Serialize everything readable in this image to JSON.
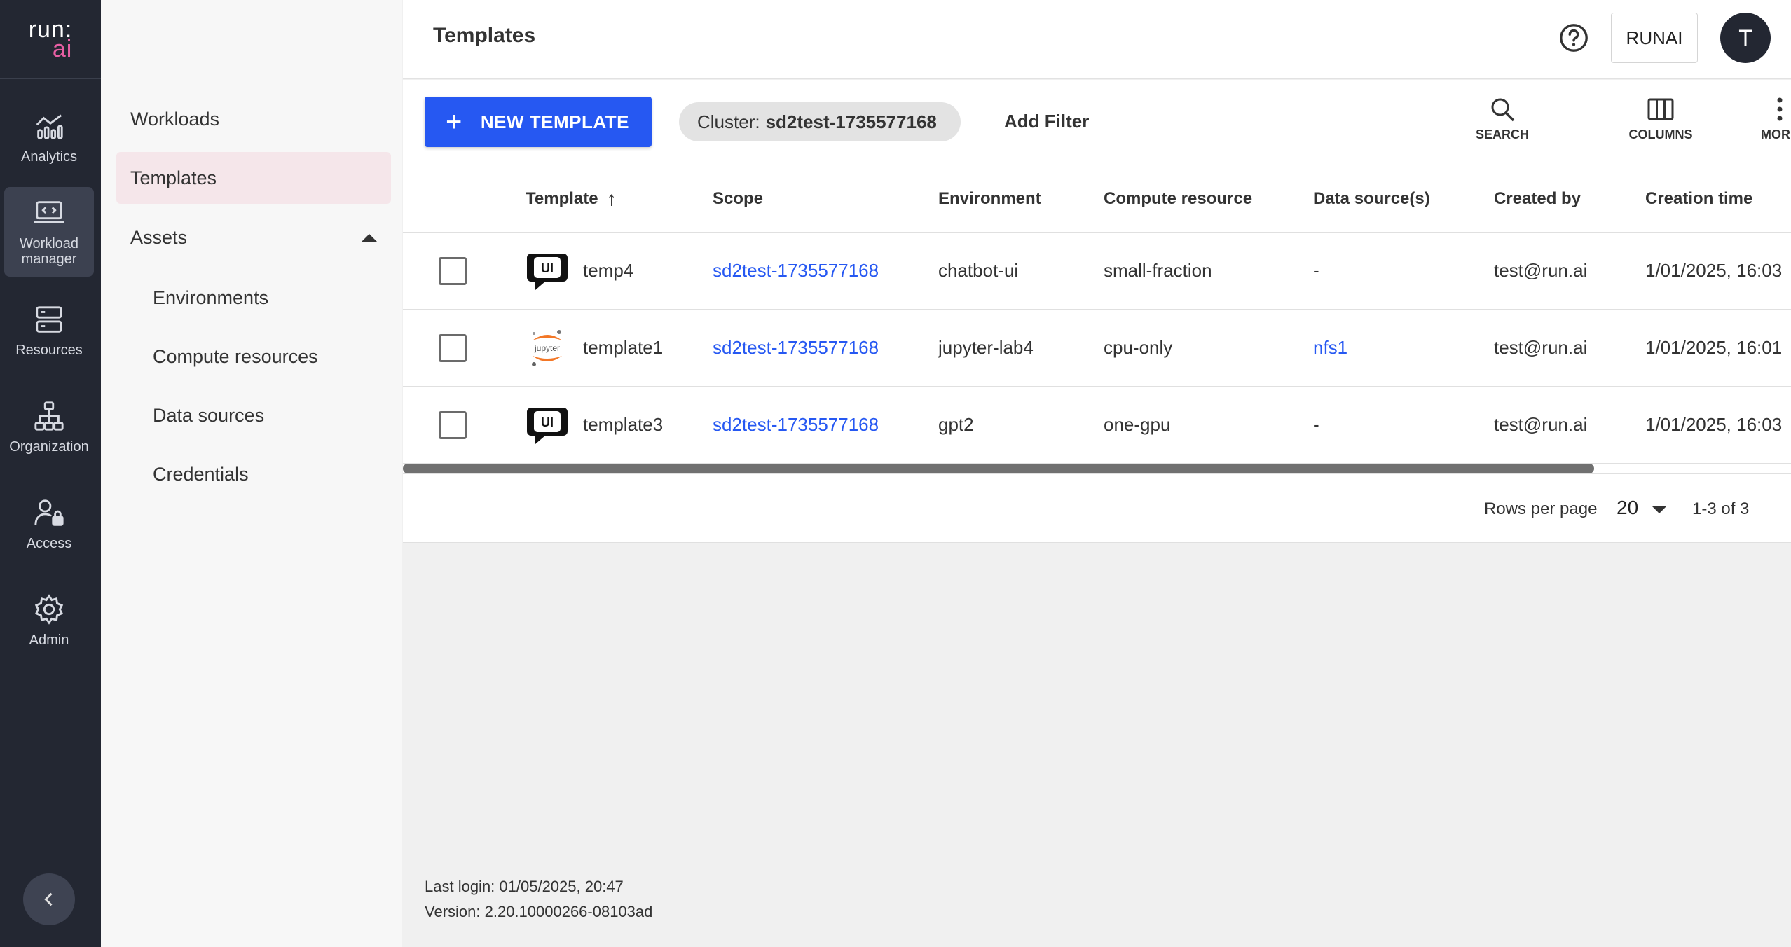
{
  "brand": {
    "line1": "run:",
    "line2": "ai",
    "accent": "#e85fa4"
  },
  "rail": {
    "items": [
      {
        "label": "Analytics",
        "icon": "analytics-icon"
      },
      {
        "label": "Workload\nmanager",
        "label_l1": "Workload",
        "label_l2": "manager",
        "icon": "workload-manager-icon"
      },
      {
        "label": "Resources",
        "icon": "resources-icon"
      },
      {
        "label": "Organization",
        "icon": "organization-icon"
      },
      {
        "label": "Access",
        "icon": "access-icon"
      },
      {
        "label": "Admin",
        "icon": "gear-icon"
      }
    ]
  },
  "subnav": {
    "workloads": "Workloads",
    "templates": "Templates",
    "assets": "Assets",
    "environments": "Environments",
    "compute_resources": "Compute resources",
    "data_sources": "Data sources",
    "credentials": "Credentials"
  },
  "header": {
    "title": "Templates",
    "tenant": "RUNAI",
    "avatar_letter": "T"
  },
  "toolbar": {
    "new_template": "NEW TEMPLATE",
    "filter_key": "Cluster:",
    "filter_value": "sd2test-1735577168",
    "add_filter": "Add Filter",
    "search": "SEARCH",
    "columns": "COLUMNS",
    "more": "MORE"
  },
  "table": {
    "headers": {
      "template": "Template",
      "scope": "Scope",
      "environment": "Environment",
      "compute": "Compute resource",
      "data_sources": "Data source(s)",
      "created_by": "Created by",
      "creation_time": "Creation time"
    },
    "rows": [
      {
        "icon": "chatbot-ui-icon",
        "name": "temp4",
        "scope": "sd2test-1735577168",
        "environment": "chatbot-ui",
        "compute": "small-fraction",
        "data_source": "-",
        "created_by": "test@run.ai",
        "creation_time": "1/01/2025, 16:03"
      },
      {
        "icon": "jupyter-icon",
        "name": "template1",
        "scope": "sd2test-1735577168",
        "environment": "jupyter-lab4",
        "compute": "cpu-only",
        "data_source": "nfs1",
        "created_by": "test@run.ai",
        "creation_time": "1/01/2025, 16:01"
      },
      {
        "icon": "chatbot-ui-icon",
        "name": "template3",
        "scope": "sd2test-1735577168",
        "environment": "gpt2",
        "compute": "one-gpu",
        "data_source": "-",
        "created_by": "test@run.ai",
        "creation_time": "1/01/2025, 16:03"
      }
    ]
  },
  "pagination": {
    "rows_per_page_label": "Rows per page",
    "rows_per_page": "20",
    "range": "1-3 of 3"
  },
  "meta": {
    "last_login": "Last login: 01/05/2025, 20:47",
    "version": "Version: 2.20.10000266-08103ad"
  },
  "colors": {
    "primary": "#2658f2",
    "rail_bg": "#232732",
    "active_subnav": "#f5e6ea"
  }
}
